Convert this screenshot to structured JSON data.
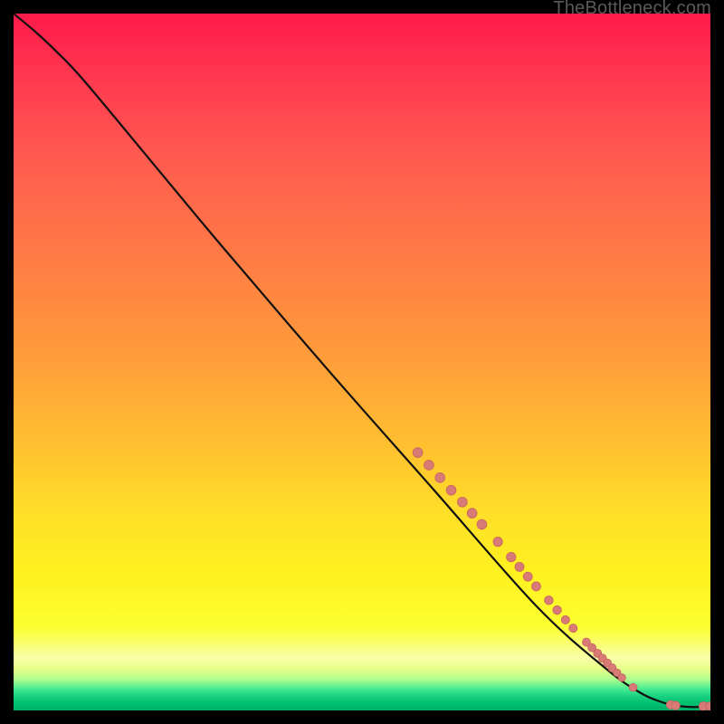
{
  "attribution": "TheBottleneck.com",
  "colors": {
    "line": "#101010",
    "dot_fill": "#d87a75",
    "dot_stroke": "#c76560",
    "bg_black": "#000000"
  },
  "chart_data": {
    "type": "line",
    "title": "",
    "xlabel": "",
    "ylabel": "",
    "xlim": [
      0,
      100
    ],
    "ylim": [
      0,
      100
    ],
    "grid": false,
    "comment": "Axes are unlabeled in the image; coordinates below are in percent of the plot area (x from left, y from bottom). Values are visual estimates.",
    "line_points": [
      {
        "x": 0,
        "y": 100
      },
      {
        "x": 3,
        "y": 97.5
      },
      {
        "x": 6,
        "y": 94.7
      },
      {
        "x": 10,
        "y": 90.5
      },
      {
        "x": 20,
        "y": 78.5
      },
      {
        "x": 30,
        "y": 66.5
      },
      {
        "x": 45,
        "y": 49.0
      },
      {
        "x": 60,
        "y": 32.0
      },
      {
        "x": 75,
        "y": 15.0
      },
      {
        "x": 85,
        "y": 6.0
      },
      {
        "x": 90,
        "y": 2.5
      },
      {
        "x": 93,
        "y": 1.2
      },
      {
        "x": 95,
        "y": 0.7
      },
      {
        "x": 97,
        "y": 0.5
      },
      {
        "x": 99,
        "y": 0.5
      },
      {
        "x": 100,
        "y": 0.5
      }
    ],
    "dots": [
      {
        "x": 58.0,
        "y": 37.0,
        "r": 5.4
      },
      {
        "x": 59.6,
        "y": 35.2,
        "r": 5.4
      },
      {
        "x": 61.2,
        "y": 33.4,
        "r": 5.4
      },
      {
        "x": 62.8,
        "y": 31.6,
        "r": 5.4
      },
      {
        "x": 64.4,
        "y": 29.9,
        "r": 5.4
      },
      {
        "x": 65.8,
        "y": 28.3,
        "r": 5.4
      },
      {
        "x": 67.2,
        "y": 26.7,
        "r": 5.4
      },
      {
        "x": 69.5,
        "y": 24.2,
        "r": 5.2
      },
      {
        "x": 71.4,
        "y": 22.0,
        "r": 5.2
      },
      {
        "x": 72.6,
        "y": 20.6,
        "r": 5.0
      },
      {
        "x": 73.8,
        "y": 19.2,
        "r": 5.0
      },
      {
        "x": 75.0,
        "y": 17.8,
        "r": 5.0
      },
      {
        "x": 76.8,
        "y": 15.8,
        "r": 4.8
      },
      {
        "x": 78.0,
        "y": 14.4,
        "r": 4.8
      },
      {
        "x": 79.2,
        "y": 13.0,
        "r": 4.6
      },
      {
        "x": 80.3,
        "y": 11.8,
        "r": 4.6
      },
      {
        "x": 82.2,
        "y": 9.8,
        "r": 4.5
      },
      {
        "x": 83.0,
        "y": 9.0,
        "r": 4.5
      },
      {
        "x": 83.8,
        "y": 8.2,
        "r": 4.5
      },
      {
        "x": 84.5,
        "y": 7.5,
        "r": 4.5
      },
      {
        "x": 85.2,
        "y": 6.8,
        "r": 4.5
      },
      {
        "x": 85.9,
        "y": 6.1,
        "r": 4.5
      },
      {
        "x": 86.6,
        "y": 5.4,
        "r": 4.2
      },
      {
        "x": 87.3,
        "y": 4.7,
        "r": 4.2
      },
      {
        "x": 88.9,
        "y": 3.3,
        "r": 4.4
      },
      {
        "x": 94.3,
        "y": 0.8,
        "r": 4.8
      },
      {
        "x": 95.0,
        "y": 0.7,
        "r": 4.8
      },
      {
        "x": 99.0,
        "y": 0.6,
        "r": 5.0
      },
      {
        "x": 100.0,
        "y": 0.6,
        "r": 5.0
      }
    ]
  }
}
